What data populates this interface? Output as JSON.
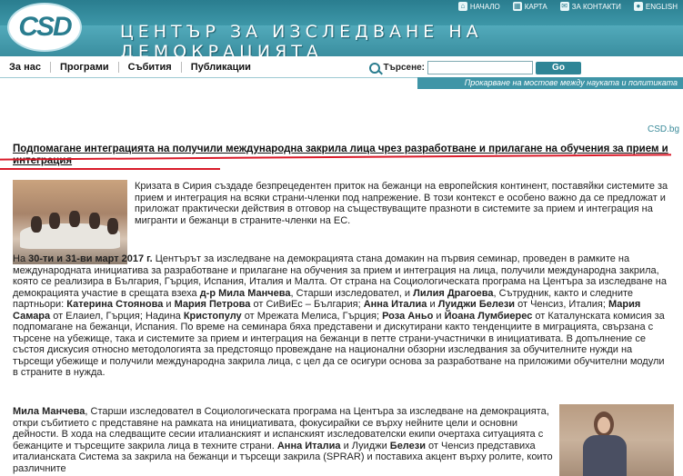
{
  "site": {
    "logo_text": "CSD",
    "title": "ЦЕНТЪР ЗА ИЗСЛЕДВАНЕ НА ДЕМОКРАЦИЯТА",
    "tagline": "Прокарване на мостове между науката и политиката",
    "site_link": "CSD.bg"
  },
  "toplinks": [
    {
      "label": "НАЧАЛО",
      "icon": "home-icon"
    },
    {
      "label": "КАРТА",
      "icon": "sitemap-icon"
    },
    {
      "label": "ЗА КОНТАКТИ",
      "icon": "mail-icon"
    },
    {
      "label": "ENGLISH",
      "icon": "globe-icon"
    }
  ],
  "nav": {
    "items": [
      "За нас",
      "Програми",
      "Събития",
      "Публикации"
    ]
  },
  "search": {
    "label": "Търсене:",
    "placeholder": "",
    "button": "Go"
  },
  "article": {
    "headline": "Подпомагане интеграцията на получили международна закрила лица чрез разработване и прилагане на обучения за прием и интеграция",
    "p1": "Кризата в Сирия създаде безпрецедентен приток на бежанци на европейския континент, поставяйки системите за прием и интеграция на всяки страни-членки под напрежение. В този контекст е особено важно да се предложат и приложат практически действия в отговор на съществуващите празноти в системите за прием и интеграция на мигранти и бежанци в страните-членки на ЕС.",
    "p2_date": "30-ти и 31-ви март 2017 г.",
    "p2_a": "На ",
    "p2_b": " Центърът за изследване на демокрацията стана домакин на първия семинар, проведен в рамките на международната инициатива за разработване и прилагане на обучения за прием и интеграция на лица, получили международна закрила, която се реализира в България, Гърция, Испания, Италия и Малта. От страна на Социологическата програма на Центъра за изследване на демокрацията участие в срещата взеха ",
    "p2_c": "д-р Мила Манчева",
    "p2_d": ", Старши изследовател, и ",
    "p2_e": "Лилия Драгоева",
    "p2_f": ", Сътрудник, както и следните партньори: ",
    "p2_g": "Катерина Стоянова",
    "p2_h": " и ",
    "p2_i": "Мария Петрова",
    "p2_j": " от СиВиЕс – България; ",
    "p2_k": "Анна Италиа",
    "p2_l": " и ",
    "p2_m": "Луиджи Белези",
    "p2_n": " от Ченсиз, Италия; ",
    "p2_o": "Мария Самара",
    "p2_p": " от Елаиел, Гърция; Надина ",
    "p2_q": "Кристопулу",
    "p2_r": " от Мрежата Мелиса, Гърция; ",
    "p2_s": "Роза Аньо",
    "p2_t": " и ",
    "p2_u": "Йоана Лумбиерес",
    "p2_v": " от Каталунската комисия за подпомагане на бежанци, Испания. По време на семинара бяха представени и дискутирани както тенденциите в миграцията, свързана с търсене на убежище, така и системите за прием и интеграция на бежанци в петте страни-участнички в инициативата. В допълнение се състоя дискусия относно методологията за предстоящо провеждане на национални обзорни изследвания за обучителните нужди на търсещи убежище и получили международна закрила лица, с цел да се осигури основа за разработване на приложими обучителни модули в страните в нужда.",
    "p3_a": "Мила Манчева",
    "p3_b": ", Старши изследовател в Социологическата програма на Центъра за изследване на демокрацията, откри събитието с представяне на рамката на инициативата, фокусирайки се върху нейните цели и основни дейности. В хода на следващите сесии италианският и испанският изследователски екипи очертаха ситуацията с бежанците и търсещите закрила лица в техните страни. ",
    "p3_c": "Анна Италиа",
    "p3_d": " и Луиджи ",
    "p3_e": "Белези",
    "p3_f": " от Ченсиз представиха италианската Система за закрила на бежанци и търсещи закрила (SPRAR) и поставиха акцент върху ролите, които различните"
  }
}
